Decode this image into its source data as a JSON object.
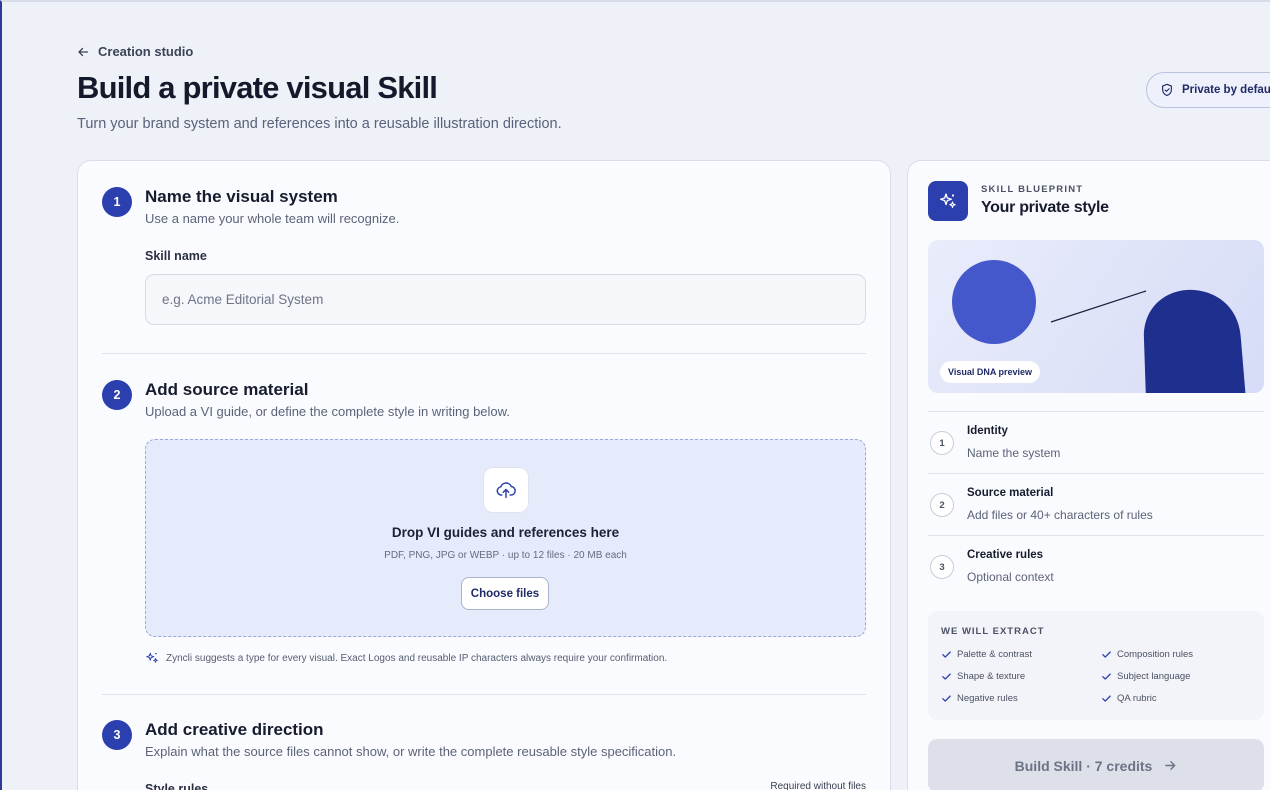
{
  "header": {
    "back_label": "Creation studio",
    "title": "Build a private visual Skill",
    "subtitle": "Turn your brand system and references into a reusable illustration direction.",
    "privacy_label": "Private by default"
  },
  "steps": [
    {
      "num": "1",
      "title": "Name the visual system",
      "desc": "Use a name your whole team will recognize.",
      "field_label": "Skill name",
      "placeholder": "e.g. Acme Editorial System",
      "value": ""
    },
    {
      "num": "2",
      "title": "Add source material",
      "desc": "Upload a VI guide, or define the complete style in writing below.",
      "drop_title": "Drop VI guides and references here",
      "drop_hint": "PDF, PNG, JPG or WEBP · up to 12 files · 20 MB each",
      "choose_label": "Choose files",
      "suggest_note": "Zyncli suggests a type for every visual. Exact Logos and reusable IP characters always require your confirmation."
    },
    {
      "num": "3",
      "title": "Add creative direction",
      "desc": "Explain what the source files cannot show, or write the complete reusable style specification.",
      "field_label": "Style rules",
      "required_note": "Required without files"
    }
  ],
  "blueprint": {
    "eyebrow": "SKILL BLUEPRINT",
    "title": "Your private style",
    "preview_badge": "Visual DNA preview",
    "steps": [
      {
        "num": "1",
        "title": "Identity",
        "desc": "Name the system"
      },
      {
        "num": "2",
        "title": "Source material",
        "desc": "Add files or 40+ characters of rules"
      },
      {
        "num": "3",
        "title": "Creative rules",
        "desc": "Optional context"
      }
    ],
    "extract_title": "WE WILL EXTRACT",
    "extract_items": [
      "Palette & contrast",
      "Composition rules",
      "Shape & texture",
      "Subject language",
      "Negative rules",
      "QA rubric"
    ],
    "build_label": "Build Skill · 7 credits"
  },
  "colors": {
    "accent": "#2b3fae",
    "background": "#eef1f8",
    "dropzone": "#e6ebfb",
    "preview_circle": "#4458cc",
    "preview_arch": "#1f2f8e"
  },
  "icons": [
    "arrow-left-icon",
    "shield-check-icon",
    "sparkles-icon",
    "upload-cloud-icon",
    "check-icon",
    "arrow-right-icon"
  ]
}
